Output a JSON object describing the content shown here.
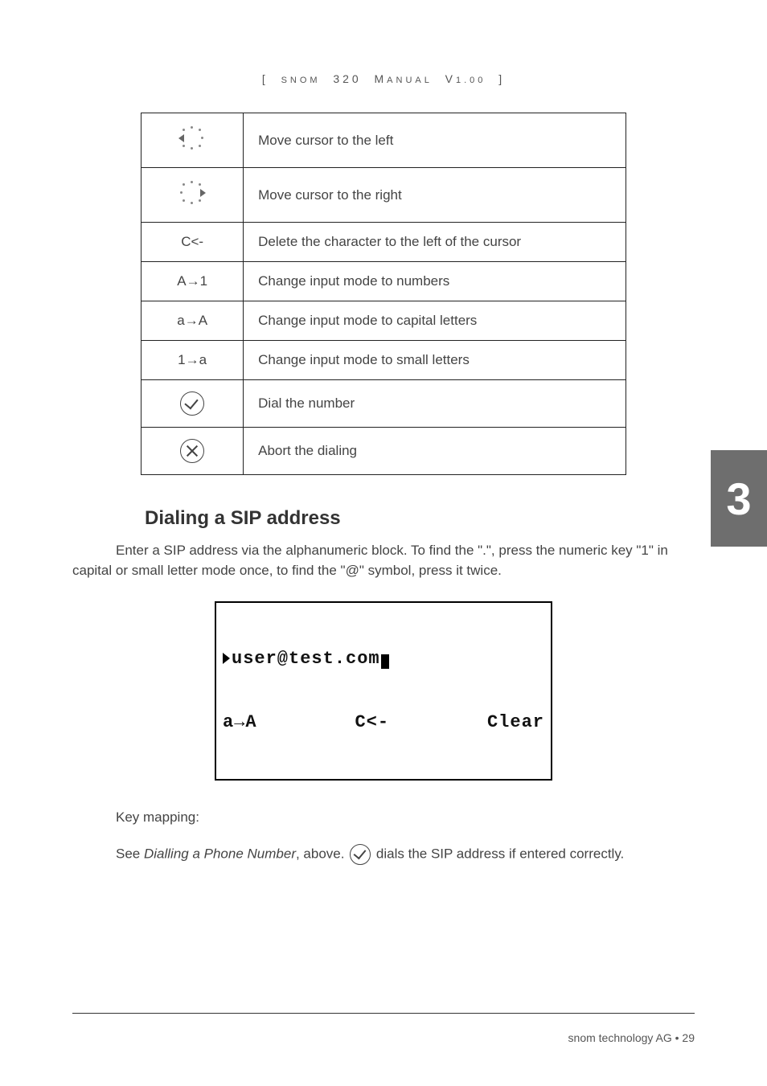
{
  "header": {
    "left_bracket": "[",
    "word1_sc": "SNOM",
    "num": "320",
    "word2_sc": "M",
    "word2_rest": "ANUAL",
    "ver_v": "V",
    "ver_num": "1.00",
    "right_bracket": "]"
  },
  "keymap": [
    {
      "key_type": "nav-left",
      "desc": "Move cursor to the left"
    },
    {
      "key_type": "nav-right",
      "desc": "Move cursor to the right"
    },
    {
      "key_label": "C<-",
      "desc": "Delete the character to the left of the cursor"
    },
    {
      "key_label": "A→1",
      "desc": "Change input mode to numbers"
    },
    {
      "key_label": "a→A",
      "desc": "Change input mode to capital letters"
    },
    {
      "key_label": "1→a",
      "desc": "Change input mode to small letters"
    },
    {
      "key_type": "check",
      "desc": "Dial the number"
    },
    {
      "key_type": "cross",
      "desc": "Abort the dialing"
    }
  ],
  "section_title": "Dialing a SIP address",
  "para1": "Enter a SIP address via the alphanumeric block.  To find the \".\", press the numeric key \"1\" in capital or small letter mode once, to find the \"@\" symbol, press it twice.",
  "lcd": {
    "line1": "user@test.com",
    "line2_left": "a→A",
    "line2_mid": "C<-",
    "line2_right": "Clear"
  },
  "keymapping_label": "Key mapping:",
  "para2_pre": "See ",
  "para2_em": "Dialling a Phone Number",
  "para2_mid": ", above.  ",
  "para2_post": " dials the SIP address if entered correctly.",
  "side_tab": "3",
  "footer": "snom technology AG  •  29"
}
